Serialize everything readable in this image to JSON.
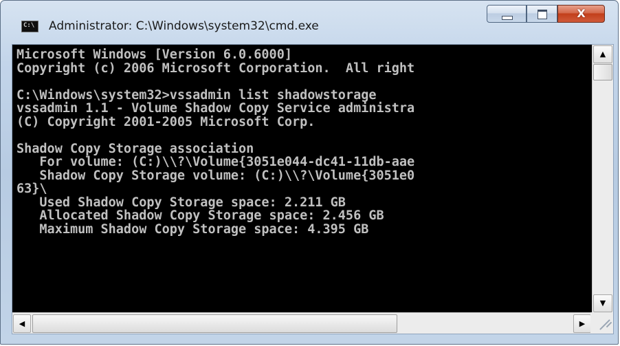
{
  "window": {
    "title": "Administrator: C:\\Windows\\system32\\cmd.exe",
    "icon_label": "C:\\",
    "close_glyph": "X"
  },
  "console": {
    "lines": [
      "Microsoft Windows [Version 6.0.6000]",
      "Copyright (c) 2006 Microsoft Corporation.  All right",
      "",
      "C:\\Windows\\system32>vssadmin list shadowstorage",
      "vssadmin 1.1 - Volume Shadow Copy Service administra",
      "(C) Copyright 2001-2005 Microsoft Corp.",
      "",
      "Shadow Copy Storage association",
      "   For volume: (C:)\\\\?\\Volume{3051e044-dc41-11db-aae",
      "   Shadow Copy Storage volume: (C:)\\\\?\\Volume{3051e0",
      "63}\\",
      "   Used Shadow Copy Storage space: 2.211 GB",
      "   Allocated Shadow Copy Storage space: 2.456 GB",
      "   Maximum Shadow Copy Storage space: 4.395 GB"
    ]
  },
  "scrollbars": {
    "up_arrow": "▲",
    "down_arrow": "▼",
    "left_arrow": "◀",
    "right_arrow": "▶"
  },
  "colors": {
    "console_bg": "#000000",
    "console_fg": "#c0c0c0",
    "close_button": "#c23f1b"
  }
}
